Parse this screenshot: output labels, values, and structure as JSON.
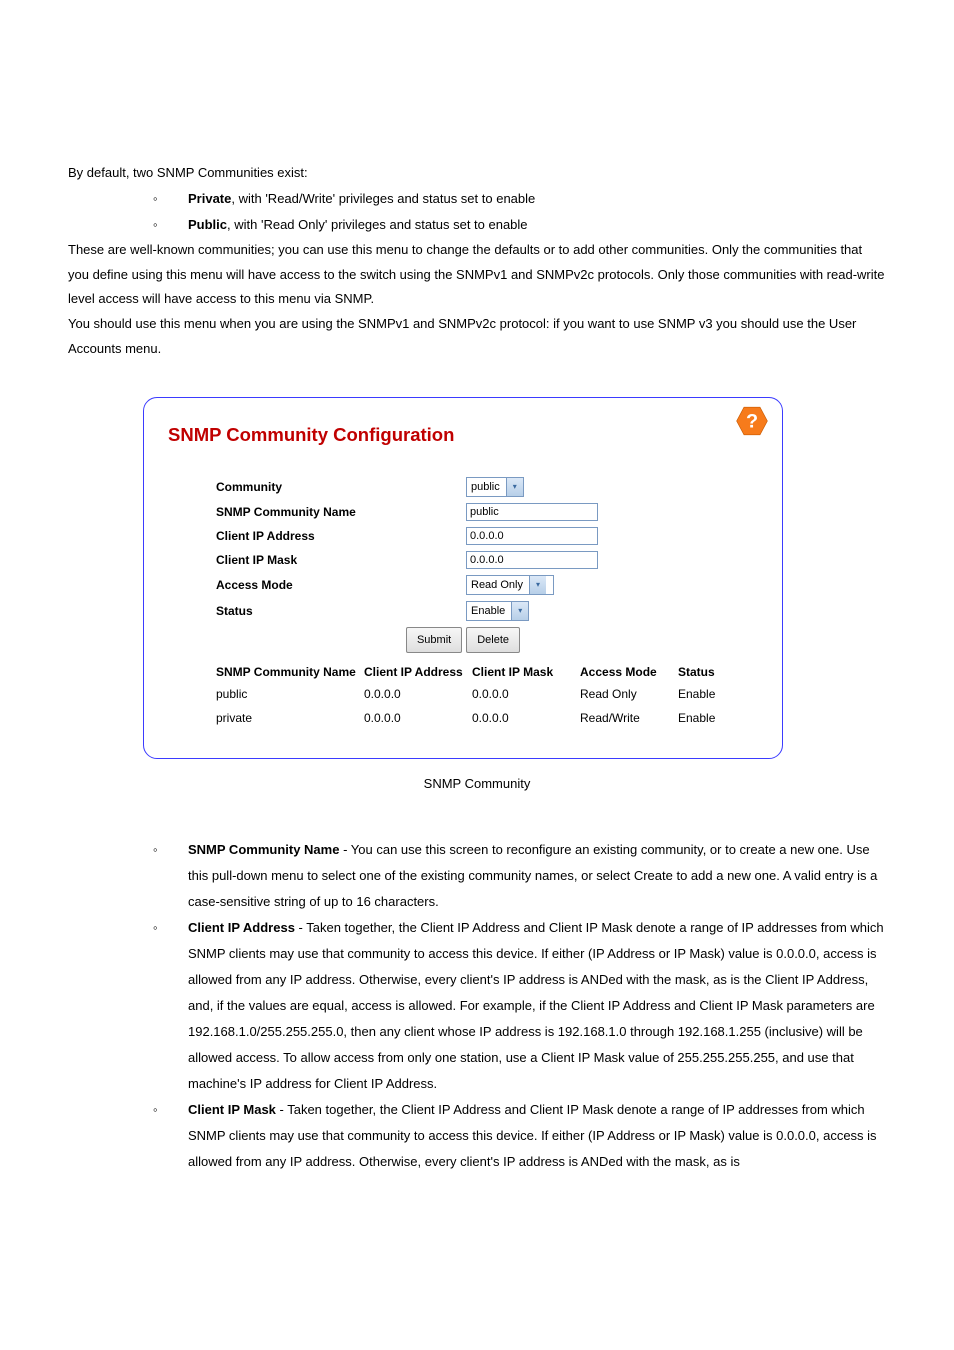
{
  "intro": {
    "p1": "By default, two SNMP Communities exist:",
    "b1_strong": "Private",
    "b1_rest": ", with 'Read/Write' privileges and status set to enable",
    "b2_strong": "Public",
    "b2_rest": ", with 'Read Only' privileges and status set to enable",
    "p2": "These are well-known communities; you can use this menu to change the defaults or to add other communities. Only the communities that you define using this menu will have access to the switch using the SNMPv1 and SNMPv2c protocols. Only those communities with read-write level access will have access to this menu via SNMP.",
    "p3": "You should use this menu when you are using the SNMPv1 and SNMPv2c protocol: if you want to use SNMP v3 you should use the User Accounts menu."
  },
  "figure": {
    "title": "SNMP Community Configuration",
    "rows": {
      "community": {
        "label": "Community",
        "value": "public"
      },
      "name": {
        "label": "SNMP Community Name",
        "value": "public"
      },
      "ip": {
        "label": "Client IP Address",
        "value": "0.0.0.0"
      },
      "mask": {
        "label": "Client IP Mask",
        "value": "0.0.0.0"
      },
      "mode": {
        "label": "Access Mode",
        "value": "Read Only"
      },
      "status": {
        "label": "Status",
        "value": "Enable"
      }
    },
    "buttons": {
      "submit": "Submit",
      "delete": "Delete"
    },
    "table": {
      "headers": [
        "SNMP Community Name",
        "Client IP Address",
        "Client IP Mask",
        "Access Mode",
        "Status"
      ],
      "rows": [
        {
          "name": "public",
          "ip": "0.0.0.0",
          "mask": "0.0.0.0",
          "mode": "Read Only",
          "status": "Enable"
        },
        {
          "name": "private",
          "ip": "0.0.0.0",
          "mask": "0.0.0.0",
          "mode": "Read/Write",
          "status": "Enable"
        }
      ]
    }
  },
  "caption": "SNMP Community",
  "desc": {
    "d1_strong": "SNMP Community Name",
    "d1_text": " - You can use this screen to reconfigure an existing community, or to create a new one. Use this pull-down menu to select one of the existing community names, or select ",
    "d1_em": "Create",
    "d1_tail": " to add a new one. A valid entry is a case-sensitive string of up to 16 characters.",
    "d2_strong": "Client IP Address",
    "d2_text": " - Taken together, the Client IP Address and Client IP Mask denote a range of IP addresses from which SNMP clients may use that community to access this device. If either (IP Address or IP Mask) value is 0.0.0.0, access is allowed from any IP address. Otherwise, every client's IP address is ANDed with the mask, as is the Client IP Address, and, if the values are equal, access is allowed. For example, if the Client IP Address and Client IP Mask parameters are 192.168.1.0/255.255.255.0, then any client whose IP address is 192.168.1.0 through 192.168.1.255 (inclusive) will be allowed access. To allow access from only one station, use a Client IP Mask value of 255.255.255.255, and use that machine's IP address for Client IP Address.",
    "d3_strong": "Client IP Mask",
    "d3_text": " - Taken together, the Client IP Address and Client IP Mask denote a range of IP addresses from which SNMP clients may use that community to access this device. If either (IP Address or IP Mask) value is 0.0.0.0, access is allowed from any IP address. Otherwise, every client's IP address is ANDed with the mask, as is"
  }
}
